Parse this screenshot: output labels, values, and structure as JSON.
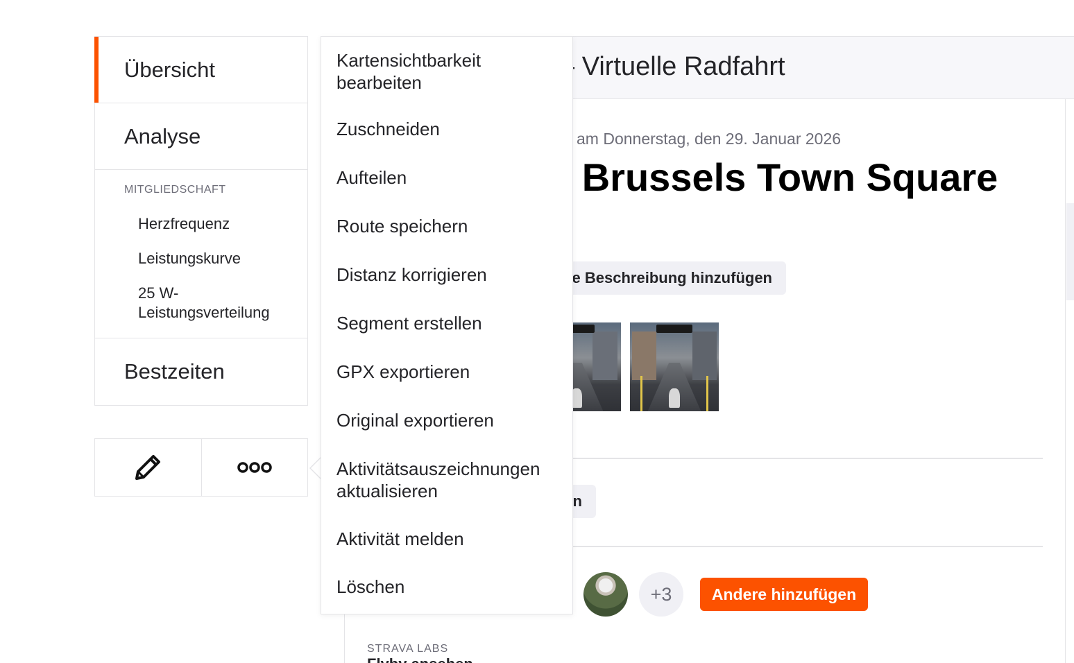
{
  "sidebar": {
    "items": [
      {
        "label": "Übersicht",
        "active": true
      },
      {
        "label": "Analyse",
        "active": false
      }
    ],
    "group": {
      "title": "MITGLIEDSCHAFT",
      "items": [
        "Herzfrequenz",
        "Leistungskurve",
        "25 W-Leistungsverteilung"
      ]
    },
    "bottom_item": "Bestzeiten",
    "actions": [
      {
        "icon": "pencil-icon"
      },
      {
        "icon": "more-horizontal-icon"
      }
    ]
  },
  "activity": {
    "header_title": "– Virtuelle Radfahrt",
    "date_line": "am Donnerstag, den 29. Januar 2026",
    "title": "yWhoosh - Brussels Town Square",
    "description_button": "e Beschreibung hinzufügen",
    "kudos_button_partial": "n",
    "more_count": "+3",
    "add_others_button": "Andere hinzufügen",
    "labs_title": "STRAVA LABS",
    "labs_sub": "Flyby ansehen"
  },
  "menu": {
    "items": [
      "Kartensichtbarkeit bearbeiten",
      "Zuschneiden",
      "Aufteilen",
      "Route speichern",
      "Distanz korrigieren",
      "Segment erstellen",
      "GPX exportieren",
      "Original exportieren",
      "Aktivitätsauszeichnungen aktualisieren",
      "Aktivität melden",
      "Löschen"
    ]
  },
  "colors": {
    "accent": "#fc5200",
    "border": "#e4e4e7",
    "muted_text": "#6d6d78",
    "header_bg": "#f7f7fa"
  }
}
